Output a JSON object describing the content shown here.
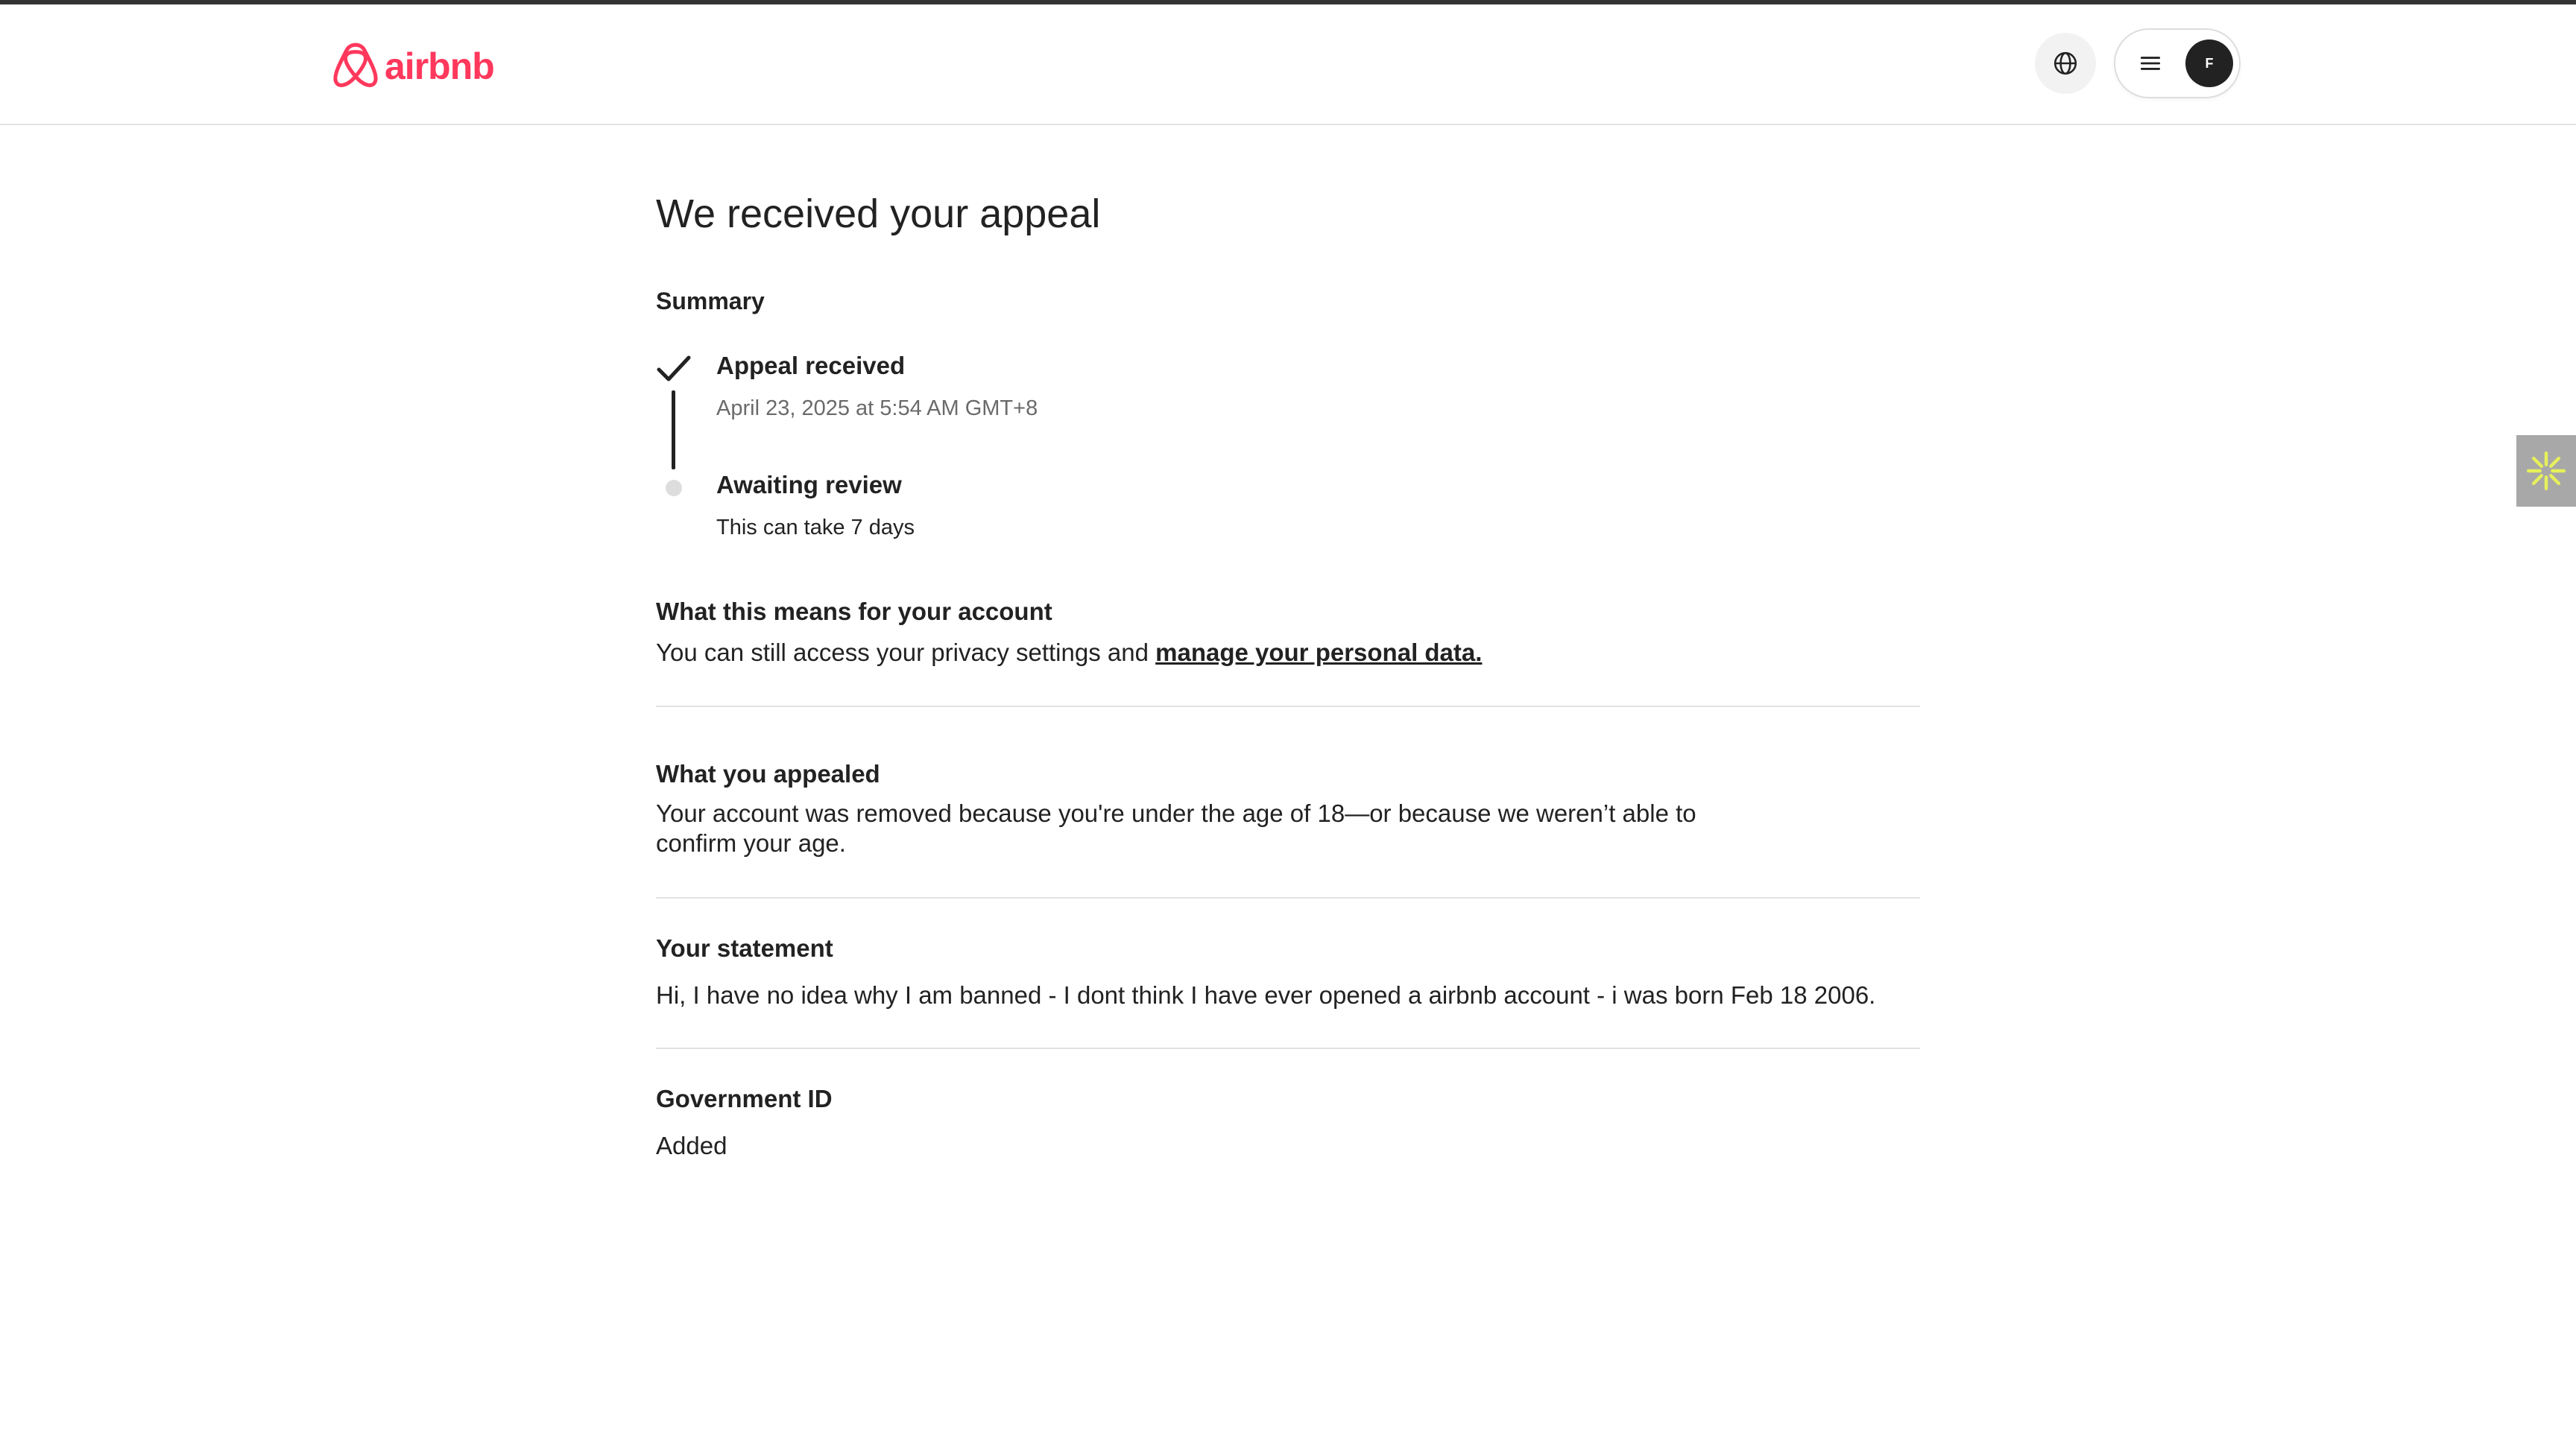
{
  "brand": {
    "name": "airbnb",
    "color": "#ff385c"
  },
  "header": {
    "globe_icon": "globe-icon",
    "menu_icon": "hamburger-menu-icon",
    "avatar_initial": "F"
  },
  "side_tab": {
    "icon": "asterisk-sparkle-icon",
    "color": "#e6f05a"
  },
  "page": {
    "title": "We received your appeal",
    "summary_label": "Summary",
    "timeline": [
      {
        "title": "Appeal received",
        "subtitle": "April 23, 2025 at 5:54 AM GMT+8",
        "status": "done"
      },
      {
        "title": "Awaiting review",
        "subtitle": "This can take 7 days",
        "status": "pending"
      }
    ],
    "account_section": {
      "title": "What this means for your account",
      "body_prefix": "You can still access your privacy settings and ",
      "link_text": "manage your personal data."
    },
    "appealed_section": {
      "title": "What you appealed",
      "body": "Your account was removed because you're under the age of 18—or because we weren’t able to confirm your age."
    },
    "statement_section": {
      "title": "Your statement",
      "body": "Hi, I have no idea why I am banned - I dont think I have ever opened a airbnb account - i was born Feb 18 2006."
    },
    "government_id_section": {
      "title": "Government ID",
      "value": "Added"
    }
  }
}
